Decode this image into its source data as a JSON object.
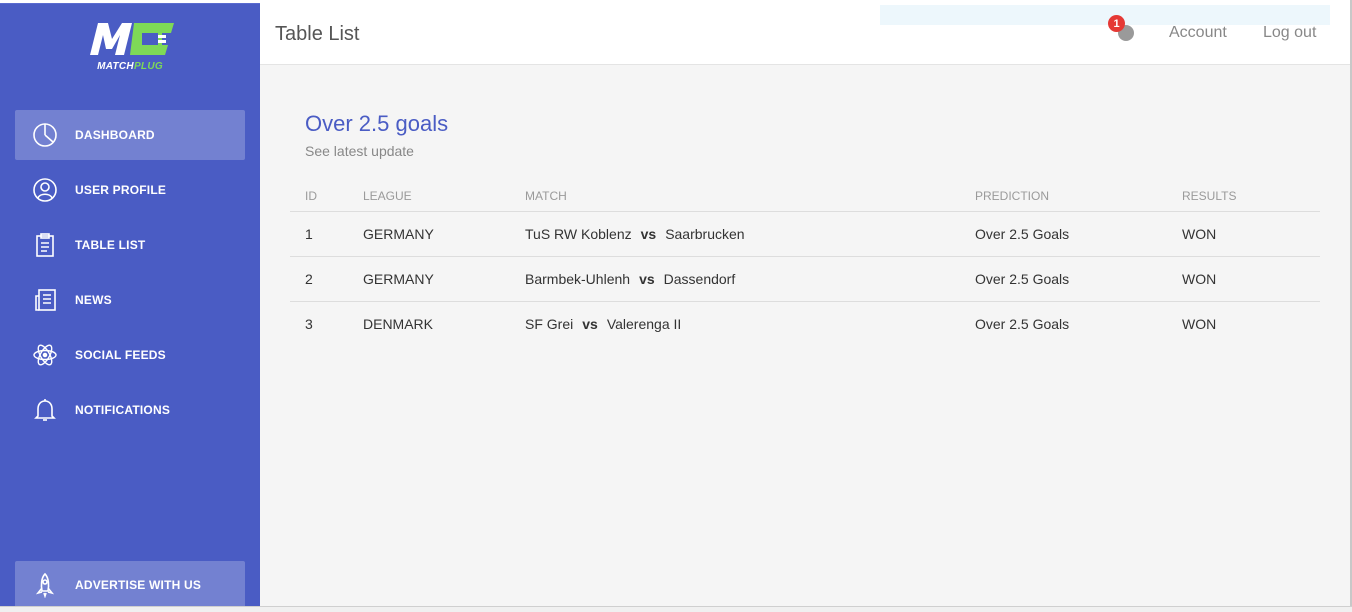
{
  "brand": {
    "word": "MATCH",
    "accent": "PLUG",
    "primary_color": "#4a5cc4",
    "accent_color": "#7ed957"
  },
  "sidebar": {
    "items": [
      {
        "label": "DASHBOARD",
        "icon": "pie-chart-icon",
        "active": true
      },
      {
        "label": "USER PROFILE",
        "icon": "user-icon",
        "active": false
      },
      {
        "label": "TABLE LIST",
        "icon": "clipboard-icon",
        "active": false
      },
      {
        "label": "NEWS",
        "icon": "newspaper-icon",
        "active": false
      },
      {
        "label": "SOCIAL FEEDS",
        "icon": "atom-icon",
        "active": false
      },
      {
        "label": "NOTIFICATIONS",
        "icon": "bell-icon",
        "active": false
      }
    ],
    "advertise": {
      "label": "ADVERTISE WITH US",
      "icon": "rocket-icon"
    }
  },
  "topbar": {
    "title": "Table List",
    "notification_count": "1",
    "account_label": "Account",
    "logout_label": "Log out"
  },
  "card": {
    "title": "Over 2.5 goals",
    "subtitle": "See latest update",
    "columns": [
      "ID",
      "LEAGUE",
      "MATCH",
      "PREDICTION",
      "RESULTS"
    ],
    "vs_label": "vs",
    "rows": [
      {
        "id": "1",
        "league": "GERMANY",
        "home": "TuS RW Koblenz",
        "away": "Saarbrucken",
        "prediction": "Over 2.5 Goals",
        "result": "WON"
      },
      {
        "id": "2",
        "league": "GERMANY",
        "home": "Barmbek-Uhlenh",
        "away": "Dassendorf",
        "prediction": "Over 2.5 Goals",
        "result": "WON"
      },
      {
        "id": "3",
        "league": "DENMARK",
        "home": "SF Grei",
        "away": "Valerenga II",
        "prediction": "Over 2.5 Goals",
        "result": "WON"
      }
    ]
  }
}
